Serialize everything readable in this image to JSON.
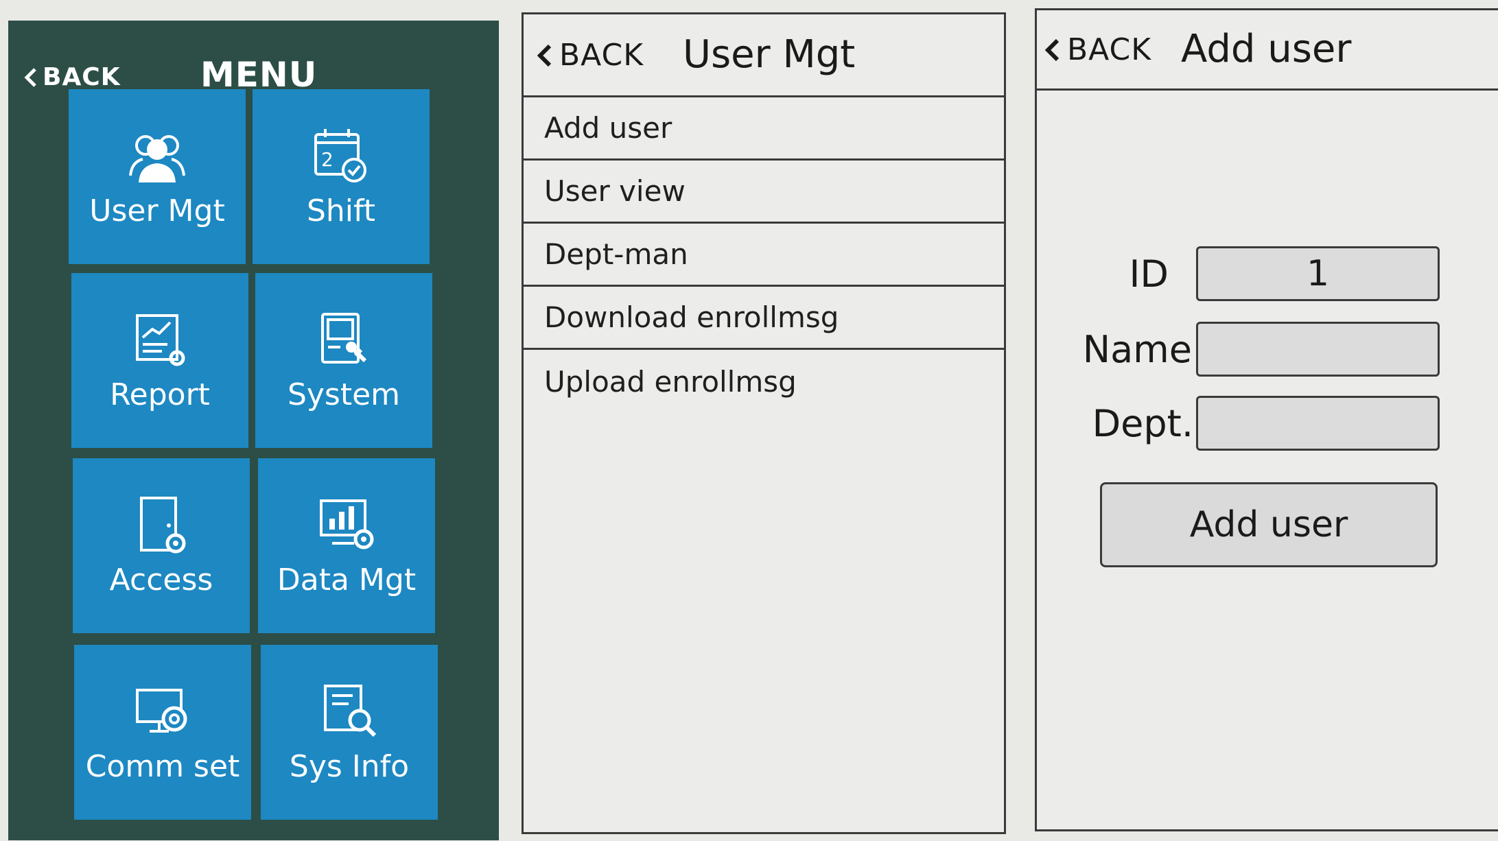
{
  "menu": {
    "back_label": "BACK",
    "title": "MENU",
    "tiles": [
      {
        "label": "User Mgt",
        "icon": "users-icon"
      },
      {
        "label": "Shift",
        "icon": "calendar-check-icon"
      },
      {
        "label": "Report",
        "icon": "report-chart-icon"
      },
      {
        "label": "System",
        "icon": "system-settings-icon"
      },
      {
        "label": "Access",
        "icon": "door-gear-icon"
      },
      {
        "label": "Data Mgt",
        "icon": "data-chart-gear-icon"
      },
      {
        "label": "Comm set",
        "icon": "monitor-gear-icon"
      },
      {
        "label": "Sys Info",
        "icon": "info-search-icon"
      }
    ],
    "colors": {
      "panel": "#2c4e46",
      "tile": "#1d88c2"
    }
  },
  "user_mgt": {
    "back_label": "BACK",
    "title": "User Mgt",
    "items": [
      "Add user",
      "User view",
      "Dept-man",
      "Download enrollmsg",
      "Upload enrollmsg"
    ]
  },
  "add_user": {
    "back_label": "BACK",
    "title": "Add user",
    "fields": [
      {
        "label": "ID",
        "value": "1"
      },
      {
        "label": "Name",
        "value": ""
      },
      {
        "label": "Dept.",
        "value": ""
      }
    ],
    "submit_label": "Add user"
  }
}
